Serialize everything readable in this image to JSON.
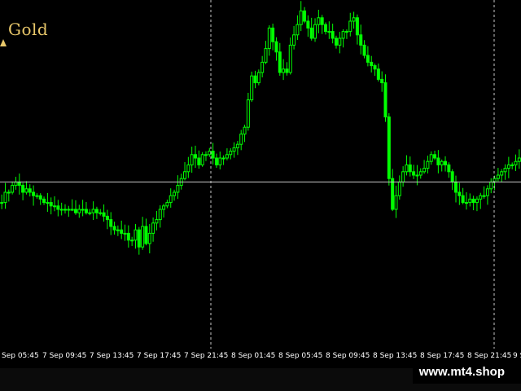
{
  "chart_data": {
    "type": "candlestick",
    "title": "Gold",
    "x_tick_labels": [
      "Sep 05:45",
      "7 Sep 09:45",
      "7 Sep 13:45",
      "7 Sep 17:45",
      "7 Sep 21:45",
      "8 Sep 01:45",
      "8 Sep 05:45",
      "8 Sep 09:45",
      "8 Sep 13:45",
      "8 Sep 17:45",
      "8 Sep 21:45",
      "9 S"
    ],
    "crosshair": {
      "vertical_times": [
        "7 Sep 21:45",
        "8 Sep 21:45"
      ],
      "horizontal_level_pct": 0.52
    },
    "grid": false,
    "colors": {
      "background": "#000000",
      "candles": "#00ff00",
      "crosshair": "#c8c8c8",
      "symbol": "#e8c76a"
    },
    "series": [
      {
        "values": [
          0.7,
          0.73,
          0.73,
          0.75,
          0.76,
          0.75,
          0.73,
          0.74,
          0.73,
          0.72,
          0.72,
          0.71,
          0.7,
          0.7,
          0.69,
          0.69,
          0.68,
          0.68,
          0.68,
          0.68,
          0.68,
          0.67,
          0.68,
          0.68,
          0.67,
          0.67,
          0.68,
          0.67,
          0.67,
          0.66,
          0.65,
          0.63,
          0.62,
          0.62,
          0.61,
          0.61,
          0.59,
          0.59,
          0.62,
          0.57,
          0.63,
          0.58,
          0.61,
          0.64,
          0.65,
          0.68,
          0.69,
          0.7,
          0.72,
          0.73,
          0.75,
          0.77,
          0.79,
          0.81,
          0.84,
          0.83,
          0.81,
          0.84,
          0.84,
          0.85,
          0.83,
          0.81,
          0.83,
          0.83,
          0.84,
          0.85,
          0.86,
          0.87,
          0.9,
          0.92,
          1.0,
          1.07,
          1.05,
          1.08,
          1.11,
          1.15,
          1.21,
          1.17,
          1.14,
          1.08,
          1.09,
          1.08,
          1.16,
          1.19,
          1.22,
          1.26,
          1.23,
          1.21,
          1.18,
          1.22,
          1.24,
          1.22,
          1.2,
          1.2,
          1.18,
          1.16,
          1.18,
          1.2,
          1.2,
          1.23,
          1.24,
          1.19,
          1.16,
          1.13,
          1.11,
          1.1,
          1.09,
          1.06,
          1.05,
          0.95,
          0.77,
          0.68,
          0.72,
          0.76,
          0.79,
          0.81,
          0.79,
          0.78,
          0.78,
          0.79,
          0.8,
          0.82,
          0.84,
          0.83,
          0.81,
          0.82,
          0.81,
          0.79,
          0.76,
          0.73,
          0.72,
          0.7,
          0.7,
          0.71,
          0.7,
          0.71,
          0.72,
          0.72,
          0.74,
          0.76,
          0.77,
          0.78,
          0.79,
          0.8,
          0.81,
          0.81,
          0.82,
          0.83
        ]
      }
    ]
  },
  "watermark": "www.mt4.shop"
}
